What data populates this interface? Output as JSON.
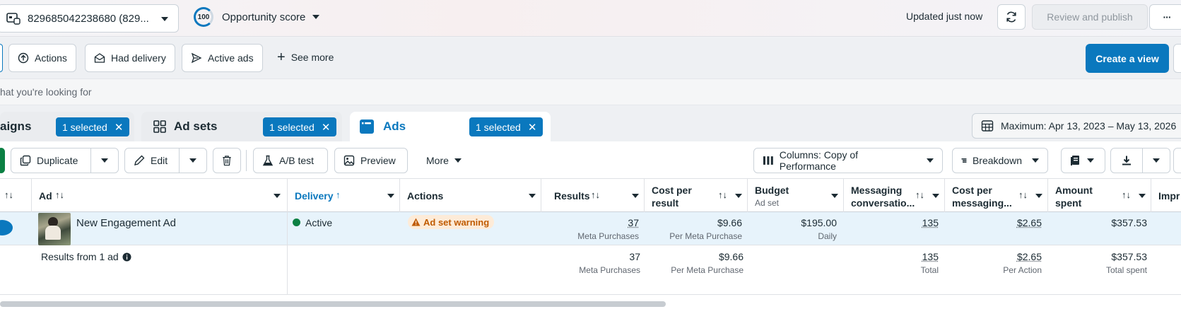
{
  "topbar": {
    "account_label": "829685042238680 (829...",
    "opportunity_score": "100",
    "opportunity_label": "Opportunity score",
    "updated_text": "Updated just now",
    "review_label": "Review and publish",
    "more_label": "···"
  },
  "filters": {
    "chips": [
      "Actions",
      "Had delivery",
      "Active ads"
    ],
    "see_more": "See more",
    "create_view": "Create a view"
  },
  "search": {
    "placeholder": "hat you're looking for"
  },
  "tabs": {
    "campaigns": "aigns",
    "campaigns_selected": "1 selected",
    "adsets": "Ad sets",
    "adsets_selected": "1 selected",
    "ads": "Ads",
    "ads_selected": "1 selected",
    "date_range": "Maximum: Apr 13, 2023 – May 13, 2026"
  },
  "toolbar": {
    "duplicate": "Duplicate",
    "edit": "Edit",
    "ab_test": "A/B test",
    "preview": "Preview",
    "more": "More",
    "columns": "Columns: Copy of Performance",
    "breakdown": "Breakdown"
  },
  "table": {
    "headers": {
      "ad": "Ad",
      "delivery": "Delivery",
      "actions": "Actions",
      "results": "Results",
      "cpr_1": "Cost per",
      "cpr_2": "result",
      "budget": "Budget",
      "budget_sub": "Ad set",
      "msg_1": "Messaging",
      "msg_2": "conversatio...",
      "cpm_1": "Cost per",
      "cpm_2": "messaging...",
      "spent_1": "Amount",
      "spent_2": "spent",
      "impr": "Impr"
    },
    "row": {
      "name": "New Engagement Ad",
      "delivery": "Active",
      "warning": "Ad set warning",
      "results": "37",
      "results_sub": "Meta Purchases",
      "cpr": "$9.66",
      "cpr_sub": "Per Meta Purchase",
      "budget": "$195.00",
      "budget_sub": "Daily",
      "msg": "135",
      "cpm": "$2.65",
      "spent": "$357.53"
    },
    "footer": {
      "label": "Results from 1 ad",
      "results": "37",
      "results_sub": "Meta Purchases",
      "cpr": "$9.66",
      "cpr_sub": "Per Meta Purchase",
      "msg": "135",
      "msg_sub": "Total",
      "cpm": "$2.65",
      "cpm_sub": "Per Action",
      "spent": "$357.53",
      "spent_sub": "Total spent"
    }
  },
  "colors": {
    "accent": "#0a78be",
    "active_green": "#0b8043",
    "warning": "#c05b00"
  }
}
